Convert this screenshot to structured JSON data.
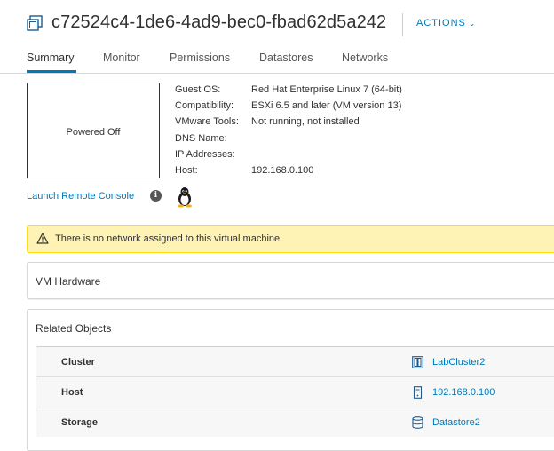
{
  "vm": {
    "name": "c72524c4-1de6-4ad9-bec0-fbad62d5a242",
    "actions_label": "ACTIONS",
    "power_state": "Powered Off",
    "console_link": "Launch Remote Console"
  },
  "tabs": [
    {
      "label": "Summary",
      "active": true
    },
    {
      "label": "Monitor",
      "active": false
    },
    {
      "label": "Permissions",
      "active": false
    },
    {
      "label": "Datastores",
      "active": false
    },
    {
      "label": "Networks",
      "active": false
    }
  ],
  "properties": [
    {
      "label": "Guest OS:",
      "value": "Red Hat Enterprise Linux 7 (64-bit)"
    },
    {
      "label": "Compatibility:",
      "value": "ESXi 6.5 and later (VM version 13)"
    },
    {
      "label": "VMware Tools:",
      "value": "Not running, not installed"
    },
    {
      "label": "DNS Name:",
      "value": ""
    },
    {
      "label": "IP Addresses:",
      "value": ""
    },
    {
      "label": "Host:",
      "value": "192.168.0.100"
    }
  ],
  "alert": {
    "text": "There is no network assigned to this virtual machine."
  },
  "hardware_card": {
    "title": "VM Hardware"
  },
  "related_objects": {
    "title": "Related Objects",
    "rows": [
      {
        "label": "Cluster",
        "value": "LabCluster2",
        "icon": "cluster-icon"
      },
      {
        "label": "Host",
        "value": "192.168.0.100",
        "icon": "host-icon"
      },
      {
        "label": "Storage",
        "value": "Datastore2",
        "icon": "datastore-icon"
      }
    ]
  },
  "colors": {
    "link": "#0079b8",
    "alert_bg": "#fef3b5",
    "alert_border": "#ffdc0b",
    "text": "#313131"
  }
}
